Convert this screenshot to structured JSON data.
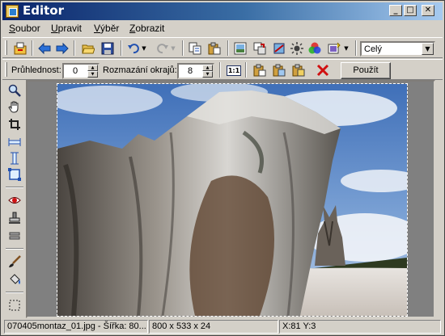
{
  "window": {
    "title": "Editor"
  },
  "menu": [
    {
      "label": "Soubor",
      "accel": "S",
      "rest": "oubor"
    },
    {
      "label": "Upravit",
      "accel": "U",
      "rest": "pravit"
    },
    {
      "label": "Výběr",
      "accel": "V",
      "rest": "ýběr"
    },
    {
      "label": "Zobrazit",
      "accel": "Z",
      "rest": "obrazit"
    }
  ],
  "zoom": {
    "value": "Celý"
  },
  "options": {
    "transparency_label": "Průhlednost:",
    "transparency_value": "0",
    "feather_label": "Rozmazání okrajů:",
    "feather_value": "8",
    "ratio_label": "1:1",
    "apply_label": "Použít"
  },
  "status": {
    "file": "070405montaz_01.jpg - Šířka: 80...",
    "dimensions": "800 x 533 x 24",
    "coords": "X:81  Y:3"
  },
  "colors": {
    "title_start": "#0a246a",
    "title_end": "#a6caf0",
    "face": "#d4d0c8",
    "canvas_bg": "#808080",
    "cancel_red": "#d01010"
  }
}
